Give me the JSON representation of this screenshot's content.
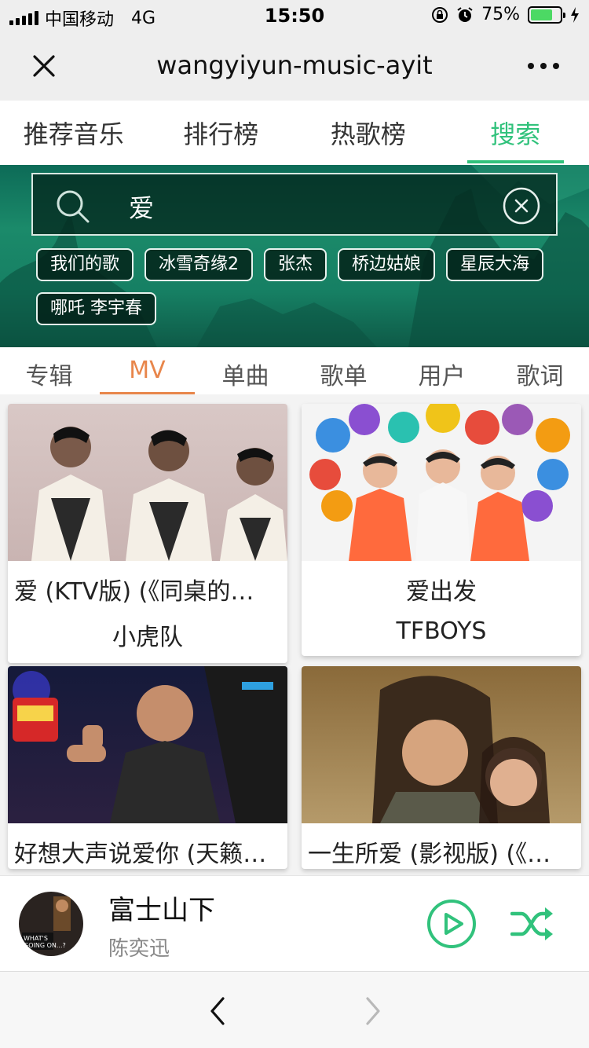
{
  "status": {
    "carrier": "中国移动",
    "network": "4G",
    "time": "15:50",
    "battery_text": "75%",
    "battery_level": 0.75
  },
  "nav": {
    "title": "wangyiyun-music-ayit"
  },
  "main_tabs": [
    {
      "label": "推荐音乐"
    },
    {
      "label": "排行榜"
    },
    {
      "label": "热歌榜"
    },
    {
      "label": "搜索"
    }
  ],
  "search": {
    "value": "爱",
    "hot_tags": [
      "我们的歌",
      "冰雪奇缘2",
      "张杰",
      "桥边姑娘",
      "星辰大海",
      "哪吒 李宇春"
    ]
  },
  "sub_tabs": [
    {
      "label": "专辑"
    },
    {
      "label": "MV"
    },
    {
      "label": "单曲"
    },
    {
      "label": "歌单"
    },
    {
      "label": "用户"
    },
    {
      "label": "歌词"
    }
  ],
  "mv_results": [
    {
      "title": "爱 (KTV版) (《同桌的…",
      "artist": "小虎队"
    },
    {
      "title": "爱出发",
      "artist": "TFBOYS"
    },
    {
      "title": "好想大声说爱你 (天籁…",
      "artist": ""
    },
    {
      "title": "一生所爱 (影视版) (《…",
      "artist": ""
    }
  ],
  "now_playing": {
    "song": "富士山下",
    "singer": "陈奕迅"
  },
  "colors": {
    "accent_green": "#31c27c",
    "accent_orange": "#e8864b",
    "hero_green": "#1b8a6a"
  }
}
